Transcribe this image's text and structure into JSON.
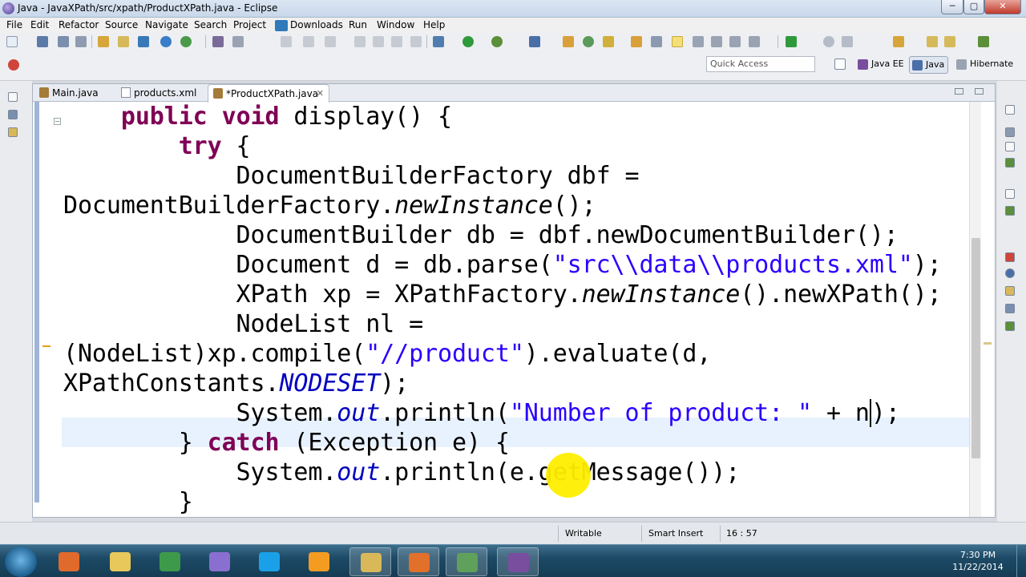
{
  "window": {
    "title": "Java - JavaXPath/src/xpath/ProductXPath.java - Eclipse",
    "min_label": "─",
    "max_label": "▢",
    "close_label": "✕"
  },
  "menu": [
    "File",
    "Edit",
    "Refactor",
    "Source",
    "Navigate",
    "Search",
    "Project",
    "Downloads",
    "Run",
    "Window",
    "Help"
  ],
  "toolbar": {
    "quick_access_placeholder": "Quick Access",
    "perspectives": [
      {
        "label": "Java EE",
        "icon": "java-ee-perspective-icon"
      },
      {
        "label": "Java",
        "icon": "java-perspective-icon",
        "active": true
      },
      {
        "label": "Hibernate",
        "icon": "hibernate-perspective-icon"
      }
    ]
  },
  "editor": {
    "tabs": [
      {
        "label": "Main.java",
        "icon": "java-file-icon"
      },
      {
        "label": "products.xml",
        "icon": "xml-file-icon"
      },
      {
        "label": "*ProductXPath.java",
        "icon": "java-file-icon",
        "active": true,
        "close": "✕"
      }
    ],
    "fold_symbol": "−",
    "code": [
      [
        {
          "t": "    "
        },
        {
          "t": "public",
          "c": "kw"
        },
        {
          "t": " "
        },
        {
          "t": "void",
          "c": "kw"
        },
        {
          "t": " display() {"
        }
      ],
      [
        {
          "t": "        "
        },
        {
          "t": "try",
          "c": "kw"
        },
        {
          "t": " {"
        }
      ],
      [
        {
          "t": "            DocumentBuilderFactory dbf ="
        }
      ],
      [
        {
          "t": "DocumentBuilderFactory."
        },
        {
          "t": "newInstance",
          "c": "ital"
        },
        {
          "t": "();"
        }
      ],
      [
        {
          "t": "            DocumentBuilder db = dbf.newDocumentBuilder();"
        }
      ],
      [
        {
          "t": "            Document d = db.parse("
        },
        {
          "t": "\"src\\\\data\\\\products.xml\"",
          "c": "str"
        },
        {
          "t": ");"
        }
      ],
      [
        {
          "t": "            XPath xp = XPathFactory."
        },
        {
          "t": "newInstance",
          "c": "ital"
        },
        {
          "t": "().newXPath();"
        }
      ],
      [
        {
          "t": "            NodeList nl ="
        }
      ],
      [
        {
          "t": "(NodeList)xp.compile("
        },
        {
          "t": "\"//product\"",
          "c": "str"
        },
        {
          "t": ").evaluate(d,"
        }
      ],
      [
        {
          "t": "XPathConstants."
        },
        {
          "t": "NODESET",
          "c": "fld"
        },
        {
          "t": ");"
        }
      ],
      [
        {
          "t": "            System."
        },
        {
          "t": "out",
          "c": "fld"
        },
        {
          "t": ".println("
        },
        {
          "t": "\"Number of product: \"",
          "c": "str"
        },
        {
          "t": " + n"
        },
        {
          "t": "",
          "c": "caret"
        },
        {
          "t": ");"
        }
      ],
      [
        {
          "t": "        } "
        },
        {
          "t": "catch",
          "c": "kw"
        },
        {
          "t": " (Exception e) {"
        }
      ],
      [
        {
          "t": "            System."
        },
        {
          "t": "out",
          "c": "fld"
        },
        {
          "t": ".println(e.getMessage());"
        }
      ],
      [
        {
          "t": "        }"
        }
      ]
    ]
  },
  "status": {
    "writable": "Writable",
    "insert_mode": "Smart Insert",
    "position": "16 : 57"
  },
  "taskbar": {
    "apps": [
      {
        "name": "windows-media-player",
        "color": "#e06a2b",
        "running": false
      },
      {
        "name": "file-explorer",
        "color": "#e8c85a",
        "running": false
      },
      {
        "name": "google-chrome",
        "color": "#3c9a4a",
        "running": false
      },
      {
        "name": "game-app",
        "color": "#8a6fd0",
        "running": false
      },
      {
        "name": "skype",
        "color": "#1aa0e8",
        "running": false
      },
      {
        "name": "outlook",
        "color": "#f39c21",
        "running": false
      },
      {
        "name": "folder-window",
        "color": "#d9b85a",
        "running": true
      },
      {
        "name": "firefox",
        "color": "#e0702a",
        "running": true
      },
      {
        "name": "chart-app",
        "color": "#5fa05a",
        "running": true
      },
      {
        "name": "eclipse-java-ee",
        "color": "#7a4e9f",
        "running": true
      }
    ],
    "clock_time": "7:30 PM",
    "clock_date": "11/22/2014"
  }
}
